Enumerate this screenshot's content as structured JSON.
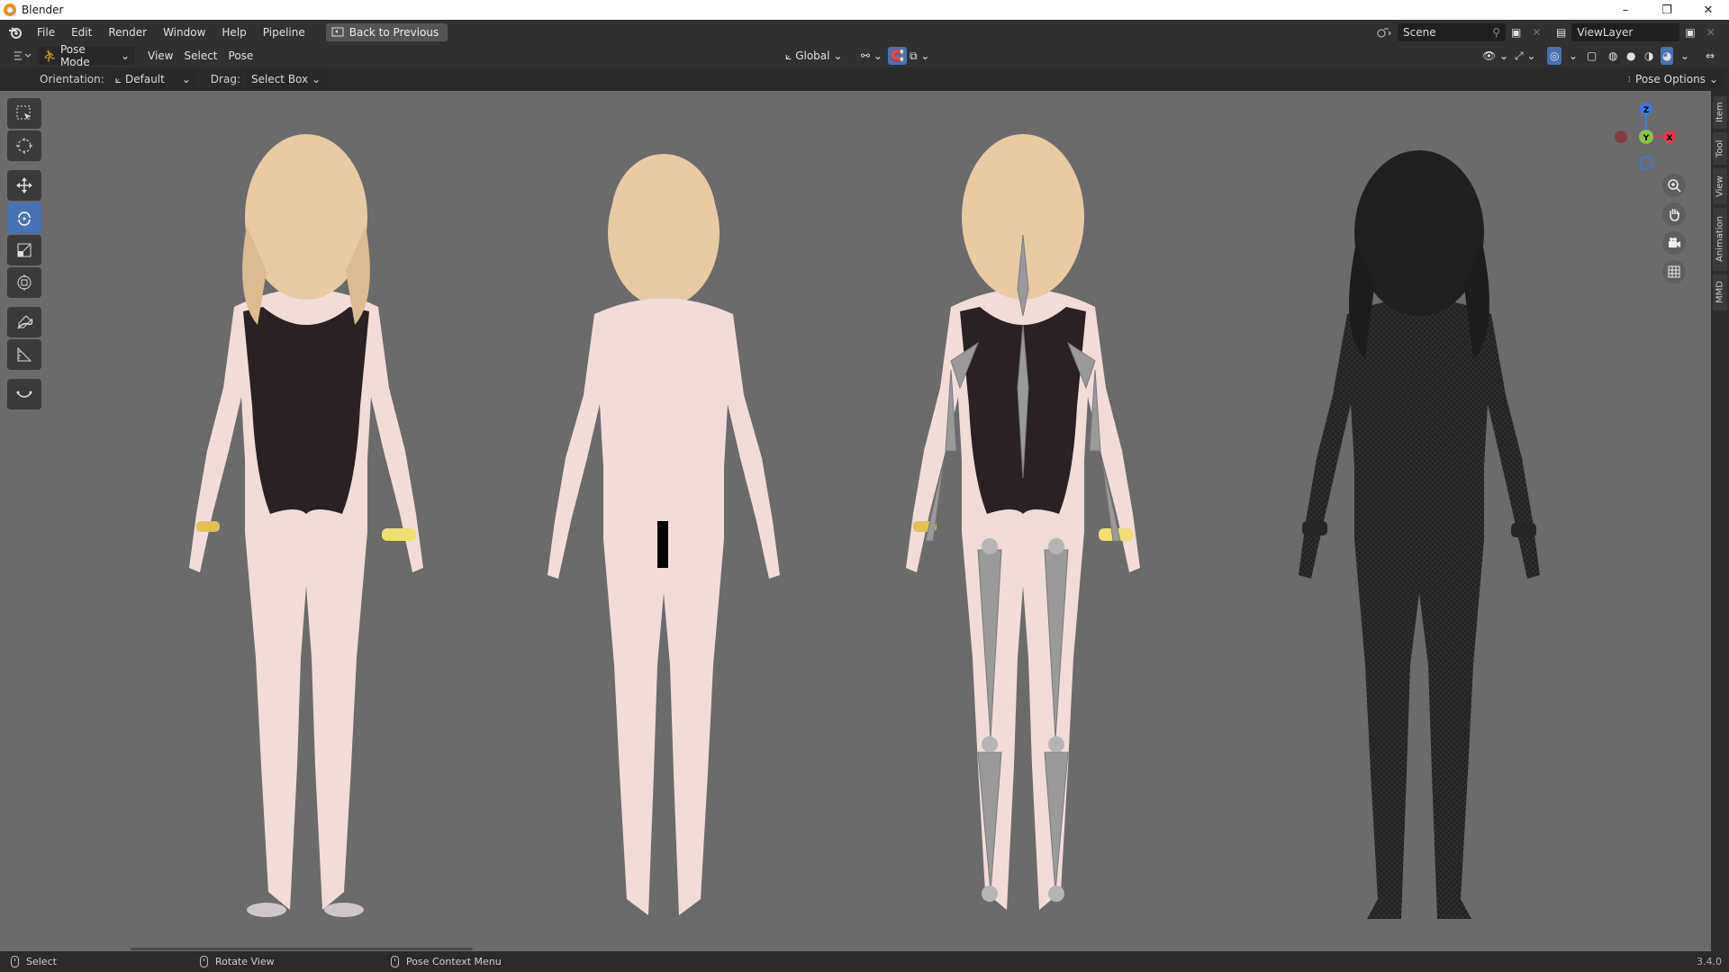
{
  "titlebar": {
    "title": "Blender",
    "minimize": "–",
    "maximize": "❐",
    "close": "✕"
  },
  "menubar": {
    "items": [
      "File",
      "Edit",
      "Render",
      "Window",
      "Help",
      "Pipeline"
    ],
    "back_button": "Back to Previous",
    "scene_name": "Scene",
    "view_layer": "ViewLayer"
  },
  "header": {
    "mode": "Pose Mode",
    "menus": [
      "View",
      "Select",
      "Pose"
    ],
    "transform_orientation": "Global"
  },
  "tool_header": {
    "orientation_label": "Orientation:",
    "orientation_value": "Default",
    "drag_label": "Drag:",
    "drag_value": "Select Box",
    "pose_options": "Pose Options"
  },
  "sidebar_tabs": [
    "Item",
    "Tool",
    "View",
    "Animation",
    "MMD"
  ],
  "toolbar": {
    "tools": [
      "select-box",
      "cursor",
      "move",
      "rotate",
      "scale",
      "transform",
      "annotate",
      "measure",
      "relax-pose"
    ],
    "active": "rotate"
  },
  "gizmo": {
    "x": "X",
    "y": "Y",
    "z": "Z"
  },
  "statusbar": {
    "left": "Select",
    "middle": "Rotate View",
    "right": "Pose Context Menu",
    "version": "3.4.0"
  },
  "colors": {
    "viewport_bg": "#6b6b6b",
    "active_tool": "#4772b3",
    "axis_x": "#e0394f",
    "axis_y": "#8bc53f",
    "axis_z": "#3b7be0",
    "hair": "#e8caa3",
    "skin": "#f2dcd8",
    "swimsuit": "#2a2124",
    "bones": "#9a9a9a",
    "wireframe": "#222222"
  }
}
